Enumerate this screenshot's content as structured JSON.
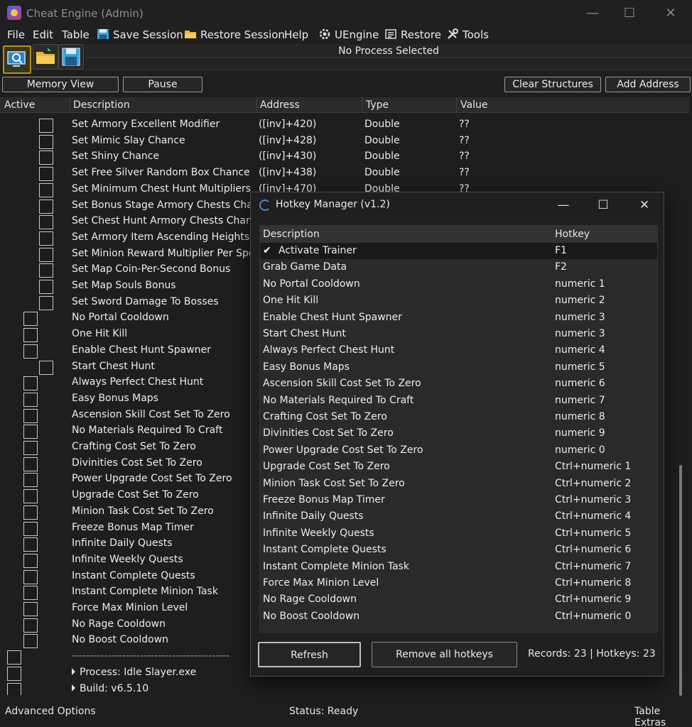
{
  "window": {
    "title": "Cheat Engine (Admin)"
  },
  "menu": [
    {
      "label": "File",
      "icon": ""
    },
    {
      "label": "Edit",
      "icon": ""
    },
    {
      "label": "Table",
      "icon": ""
    },
    {
      "label": "Save Session",
      "icon": "save-icon"
    },
    {
      "label": "Restore Session",
      "icon": "folder-icon"
    },
    {
      "label": "Help",
      "icon": ""
    },
    {
      "label": "UEngine",
      "icon": "gear-icon"
    },
    {
      "label": "Restore",
      "icon": "restore-icon"
    },
    {
      "label": "Tools",
      "icon": "tools-icon"
    }
  ],
  "process": {
    "label": "No Process Selected"
  },
  "buttons": {
    "memory_view": "Memory View",
    "pause": "Pause",
    "clear_structures": "Clear Structures",
    "add_address": "Add Address"
  },
  "columns": {
    "active": "Active",
    "description": "Description",
    "address": "Address",
    "type": "Type",
    "value": "Value"
  },
  "rows": [
    {
      "desc": "Set Armory Excellent Modifier",
      "addr": "([inv]+420)",
      "type": "Double",
      "val": "??",
      "indent": 2
    },
    {
      "desc": "Set Mimic Slay Chance",
      "addr": "([inv]+428)",
      "type": "Double",
      "val": "??",
      "indent": 2
    },
    {
      "desc": "Set Shiny Chance",
      "addr": "([inv]+430)",
      "type": "Double",
      "val": "??",
      "indent": 2
    },
    {
      "desc": "Set Free Silver Random Box Chance",
      "addr": "([inv]+438)",
      "type": "Double",
      "val": "??",
      "indent": 2
    },
    {
      "desc": "Set Minimum Chest Hunt Multipliers",
      "addr": "([inv]+470)",
      "type": "Double",
      "val": "??",
      "indent": 2
    },
    {
      "desc": "Set Bonus Stage Armory Chests Chance",
      "addr": "",
      "type": "",
      "val": "",
      "indent": 2
    },
    {
      "desc": "Set Chest Hunt Armory Chests Chance",
      "addr": "",
      "type": "",
      "val": "",
      "indent": 2
    },
    {
      "desc": "Set Armory Item Ascending Heights Ch",
      "addr": "",
      "type": "",
      "val": "",
      "indent": 2
    },
    {
      "desc": "Set Minion Reward Multiplier Per Spent",
      "addr": "",
      "type": "",
      "val": "",
      "indent": 2
    },
    {
      "desc": "Set Map Coin-Per-Second Bonus",
      "addr": "",
      "type": "",
      "val": "",
      "indent": 2
    },
    {
      "desc": "Set Map Souls Bonus",
      "addr": "",
      "type": "",
      "val": "",
      "indent": 2
    },
    {
      "desc": "Set Sword Damage To Bosses",
      "addr": "",
      "type": "",
      "val": "",
      "indent": 2
    },
    {
      "desc": "No Portal Cooldown",
      "addr": "",
      "type": "",
      "val": "",
      "indent": 1
    },
    {
      "desc": "One Hit Kill",
      "addr": "",
      "type": "",
      "val": "",
      "indent": 1
    },
    {
      "desc": "Enable Chest Hunt Spawner",
      "addr": "",
      "type": "",
      "val": "",
      "indent": 1
    },
    {
      "desc": "Start Chest Hunt",
      "addr": "",
      "type": "",
      "val": "",
      "indent": 2
    },
    {
      "desc": "Always Perfect Chest Hunt",
      "addr": "",
      "type": "",
      "val": "",
      "indent": 1
    },
    {
      "desc": "Easy Bonus Maps",
      "addr": "",
      "type": "",
      "val": "",
      "indent": 1
    },
    {
      "desc": "Ascension Skill Cost Set To Zero",
      "addr": "",
      "type": "",
      "val": "",
      "indent": 1
    },
    {
      "desc": "No Materials Required To Craft",
      "addr": "",
      "type": "",
      "val": "",
      "indent": 1
    },
    {
      "desc": "Crafting Cost Set To Zero",
      "addr": "",
      "type": "",
      "val": "",
      "indent": 1
    },
    {
      "desc": "Divinities Cost Set To Zero",
      "addr": "",
      "type": "",
      "val": "",
      "indent": 1
    },
    {
      "desc": "Power Upgrade Cost Set To Zero",
      "addr": "",
      "type": "",
      "val": "",
      "indent": 1
    },
    {
      "desc": "Upgrade Cost Set To Zero",
      "addr": "",
      "type": "",
      "val": "",
      "indent": 1
    },
    {
      "desc": "Minion Task Cost Set To Zero",
      "addr": "",
      "type": "",
      "val": "",
      "indent": 1
    },
    {
      "desc": "Freeze Bonus Map Timer",
      "addr": "",
      "type": "",
      "val": "",
      "indent": 1
    },
    {
      "desc": "Infinite Daily Quests",
      "addr": "",
      "type": "",
      "val": "",
      "indent": 1
    },
    {
      "desc": "Infinite Weekly Quests",
      "addr": "",
      "type": "",
      "val": "",
      "indent": 1
    },
    {
      "desc": "Instant Complete Quests",
      "addr": "",
      "type": "",
      "val": "",
      "indent": 1
    },
    {
      "desc": "Instant Complete Minion Task",
      "addr": "",
      "type": "",
      "val": "",
      "indent": 1
    },
    {
      "desc": "Force Max Minion Level",
      "addr": "",
      "type": "",
      "val": "",
      "indent": 1
    },
    {
      "desc": "No Rage Cooldown",
      "addr": "",
      "type": "",
      "val": "",
      "indent": 1
    },
    {
      "desc": "No Boost Cooldown",
      "addr": "",
      "type": "",
      "val": "",
      "indent": 1
    },
    {
      "desc": "--------------------------------------------",
      "addr": "",
      "type": "",
      "val": "",
      "indent": 0,
      "separator": true
    },
    {
      "desc": "Process: Idle Slayer.exe",
      "addr": "",
      "type": "",
      "val": "",
      "indent": 0,
      "group": true
    },
    {
      "desc": "Build: v6.5.10",
      "addr": "",
      "type": "",
      "val": "",
      "indent": 0,
      "group": true
    }
  ],
  "status": {
    "left": "Advanced Options",
    "center": "Status: Ready",
    "right": "Table Extras"
  },
  "hotkey_manager": {
    "title": "Hotkey Manager (v1.2)",
    "col_description": "Description",
    "col_hotkey": "Hotkey",
    "rows": [
      {
        "desc": "Activate Trainer",
        "hotkey": "F1",
        "checked": true
      },
      {
        "desc": "Grab Game Data",
        "hotkey": "F2"
      },
      {
        "desc": "No Portal Cooldown",
        "hotkey": "numeric 1"
      },
      {
        "desc": "One Hit Kill",
        "hotkey": "numeric 2"
      },
      {
        "desc": "Enable Chest Hunt Spawner",
        "hotkey": "numeric 3"
      },
      {
        "desc": "Start Chest Hunt",
        "hotkey": "numeric 3"
      },
      {
        "desc": "Always Perfect Chest Hunt",
        "hotkey": "numeric 4"
      },
      {
        "desc": "Easy Bonus Maps",
        "hotkey": "numeric 5"
      },
      {
        "desc": "Ascension Skill Cost Set To Zero",
        "hotkey": "numeric 6"
      },
      {
        "desc": "No Materials Required To Craft",
        "hotkey": "numeric 7"
      },
      {
        "desc": "Crafting Cost Set To Zero",
        "hotkey": "numeric 8"
      },
      {
        "desc": "Divinities Cost Set To Zero",
        "hotkey": "numeric 9"
      },
      {
        "desc": "Power Upgrade Cost Set To Zero",
        "hotkey": "numeric 0"
      },
      {
        "desc": "Upgrade Cost Set To Zero",
        "hotkey": "Ctrl+numeric 1"
      },
      {
        "desc": "Minion Task Cost Set To Zero",
        "hotkey": "Ctrl+numeric 2"
      },
      {
        "desc": "Freeze Bonus Map Timer",
        "hotkey": "Ctrl+numeric 3"
      },
      {
        "desc": "Infinite Daily Quests",
        "hotkey": "Ctrl+numeric 4"
      },
      {
        "desc": "Infinite Weekly Quests",
        "hotkey": "Ctrl+numeric 5"
      },
      {
        "desc": "Instant Complete Quests",
        "hotkey": "Ctrl+numeric 6"
      },
      {
        "desc": "Instant Complete Minion Task",
        "hotkey": "Ctrl+numeric 7"
      },
      {
        "desc": "Force Max Minion Level",
        "hotkey": "Ctrl+numeric 8"
      },
      {
        "desc": "No Rage Cooldown",
        "hotkey": "Ctrl+numeric 9"
      },
      {
        "desc": "No Boost Cooldown",
        "hotkey": "Ctrl+numeric 0"
      }
    ],
    "refresh_label": "Refresh",
    "remove_label": "Remove all hotkeys",
    "records_text": "Records: 23 | Hotkeys: 23"
  }
}
